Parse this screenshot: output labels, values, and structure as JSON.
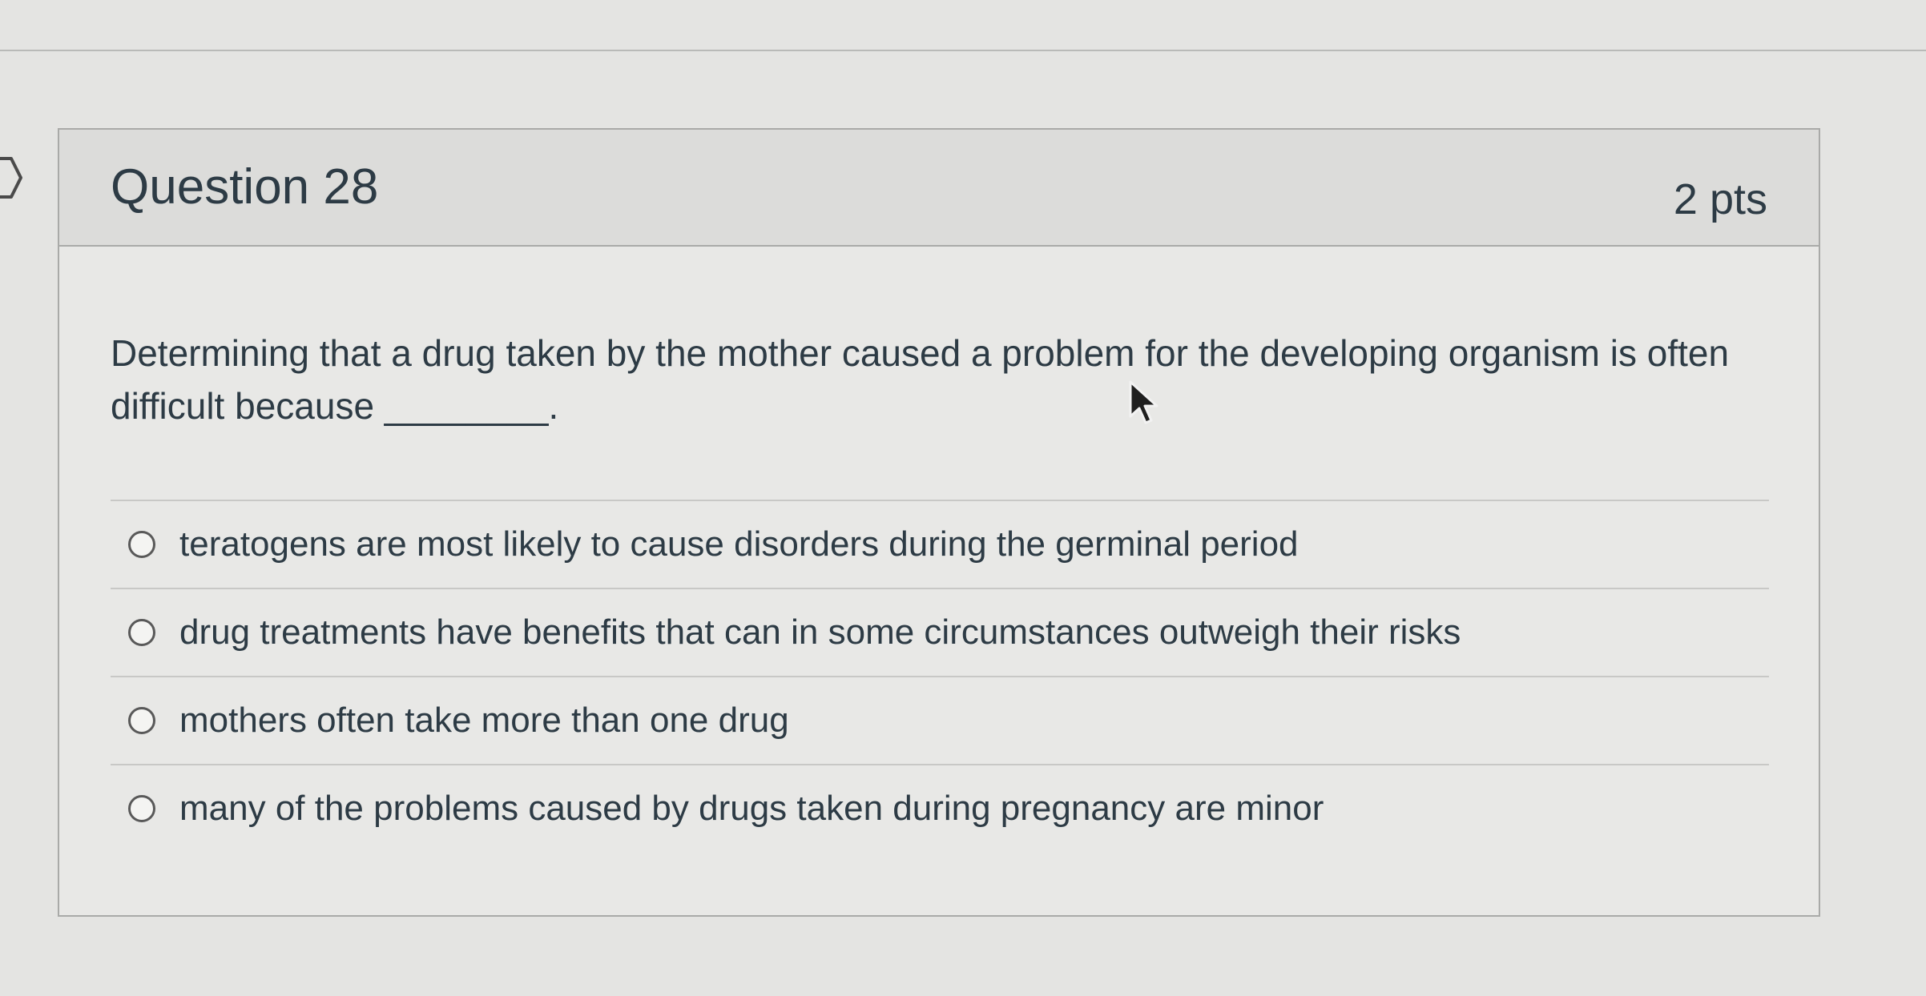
{
  "question": {
    "title": "Question 28",
    "points": "2 pts",
    "text": "Determining that a drug taken by the mother caused a problem for the developing organism is often difficult because ________.",
    "answers": [
      {
        "label": "teratogens are most likely to cause disorders during the germinal period"
      },
      {
        "label": "drug treatments have benefits that can in some circumstances outweigh their risks"
      },
      {
        "label": "mothers often take more than one drug"
      },
      {
        "label": "many of the problems caused by drugs taken during pregnancy are minor"
      }
    ]
  },
  "icons": {
    "previous_question": "chevron-right-icon",
    "answer_option": "radio-button-icon",
    "cursor": "mouse-pointer-icon"
  },
  "colors": {
    "text": "#2d3b45",
    "header_background": "#dcdcda",
    "card_background": "#e8e8e6",
    "border": "#a9aaa8"
  }
}
